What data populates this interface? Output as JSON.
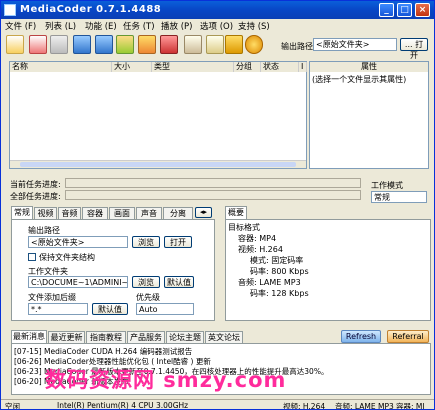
{
  "title": "MediaCoder 0.7.1.4488",
  "menu": [
    "文件 (F)",
    "列表 (L)",
    "功能 (E)",
    "任务 (T)",
    "播放 (P)",
    "选项 (O)",
    "支持 (S)"
  ],
  "toolbar": {
    "output_label": "输出路径",
    "output_value": "<原始文件夹>",
    "open_label": "... 打开"
  },
  "filelist": {
    "columns": [
      "名称",
      "大小",
      "类型",
      "分组",
      "状态",
      "I"
    ]
  },
  "props": {
    "header": "属性",
    "hint": "(选择一个文件显示其属性)"
  },
  "progress": {
    "current_label": "当前任务进度:",
    "total_label": "全部任务进度:"
  },
  "mode": {
    "label": "工作模式",
    "value": "常规"
  },
  "tabs": [
    "常规",
    "视频",
    "音频",
    "容器",
    "画面",
    "声音",
    "分离"
  ],
  "summary_tab": "概要",
  "general": {
    "output_path_label": "输出路径",
    "output_path_value": "<原始文件夹>",
    "browse": "浏览",
    "open": "打开",
    "keep_structure": "保持文件夹结构",
    "work_folder_label": "工作文件夹",
    "work_folder_value": "C:\\DOCUME~1\\ADMINI~1\\LOC",
    "default": "默认值",
    "naming_label": "文件添加后缀",
    "naming_value": "*.*",
    "priority_label": "优先级",
    "priority_value": "Auto"
  },
  "summary": {
    "root": "目标格式",
    "container": "容器: MP4",
    "video": "视频: H.264",
    "mode": "模式: 固定码率",
    "bitrate": "码率: 800 Kbps",
    "audio": "音频: LAME MP3",
    "abitrate": "码率: 128 Kbps"
  },
  "bottom_tabs": [
    "最新消息",
    "最近更新",
    "指南教程",
    "产品服务",
    "论坛主题",
    "英文论坛"
  ],
  "refresh": "Refresh",
  "referral": "Referral",
  "news": [
    "[07-15] MediaCoder CUDA H.264 编码器测试报告",
    "[06-26] MediaCoder处理器性能优化包 ( Intel酷睿 ) 更新",
    "[06-23] MediaCoder 最新版本更新至0.7.1.4450，在四核处理器上的性能提升最高达30%。",
    "[06-20] MediaCoder 新版本发布"
  ],
  "watermark": "数码资源网 smzy.com",
  "status": {
    "state": "空闲",
    "cpu": "Intel(R) Pentium(R) 4 CPU 3.00GHz",
    "video": "视频: H.264",
    "audio": "音频: LAME MP3",
    "container": "容器: MI"
  }
}
